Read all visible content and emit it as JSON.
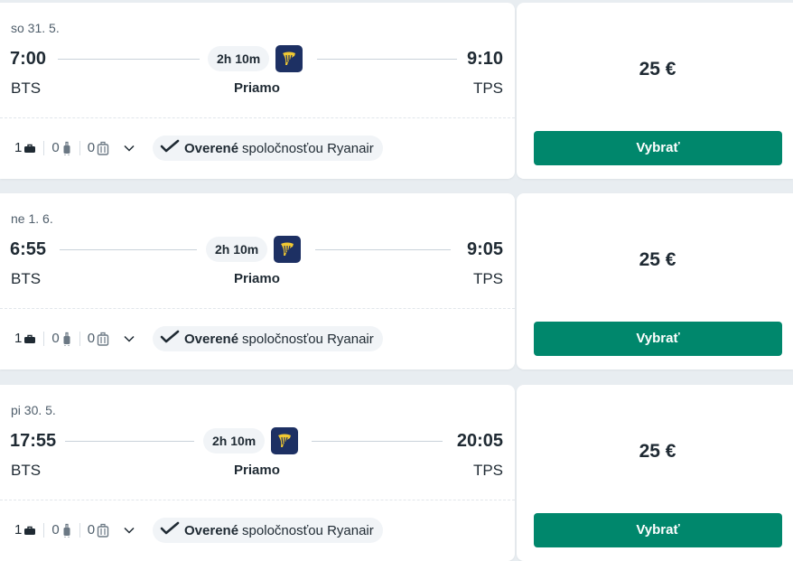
{
  "results": [
    {
      "date": "so 31. 5.",
      "departure_time": "7:00",
      "arrival_time": "9:10",
      "duration": "2h 10m",
      "from": "BTS",
      "to": "TPS",
      "stops": "Priamo",
      "bags": {
        "personal": "1",
        "cabin": "0",
        "checked": "0"
      },
      "verified_bold": "Overené",
      "verified_rest": "spoločnosťou Ryanair",
      "price": "25 €",
      "select_label": "Vybrať"
    },
    {
      "date": "ne 1. 6.",
      "departure_time": "6:55",
      "arrival_time": "9:05",
      "duration": "2h 10m",
      "from": "BTS",
      "to": "TPS",
      "stops": "Priamo",
      "bags": {
        "personal": "1",
        "cabin": "0",
        "checked": "0"
      },
      "verified_bold": "Overené",
      "verified_rest": "spoločnosťou Ryanair",
      "price": "25 €",
      "select_label": "Vybrať"
    },
    {
      "date": "pi 30. 5.",
      "departure_time": "17:55",
      "arrival_time": "20:05",
      "duration": "2h 10m",
      "from": "BTS",
      "to": "TPS",
      "stops": "Priamo",
      "bags": {
        "personal": "1",
        "cabin": "0",
        "checked": "0"
      },
      "verified_bold": "Overené",
      "verified_rest": "spoločnosťou Ryanair",
      "price": "25 €",
      "select_label": "Vybrať"
    }
  ],
  "icons": {
    "airline_logo": "ryanair-harp-icon",
    "personal_bag": "personal-bag-icon",
    "cabin_bag": "cabin-bag-icon",
    "checked_bag": "checked-bag-icon",
    "expand": "chevron-down-icon",
    "verified": "checkmark-icon"
  },
  "colors": {
    "accent_button": "#00876c",
    "airline_logo_bg": "#1d3063",
    "airline_logo_fg": "#f1c933"
  }
}
